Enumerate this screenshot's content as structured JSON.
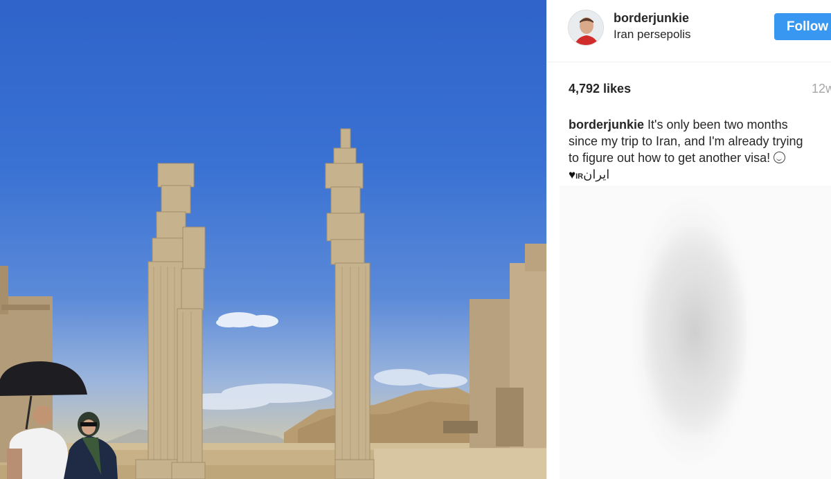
{
  "post": {
    "username": "borderjunkie",
    "location": "Iran persepolis",
    "follow_label": "Follow",
    "likes": "4,792 likes",
    "time_ago": "12w",
    "caption": {
      "username": "borderjunkie",
      "text": " It's only been two months since my trip to Iran, and I'm already trying to figure out how to get another visa! ",
      "heart": "♥",
      "flag": "IR",
      "persian": "ایران"
    }
  },
  "colors": {
    "follow_button": "#3897f0",
    "time_text": "#a7a7a7"
  },
  "icons": [
    "smiling-face-icon",
    "heart-icon"
  ]
}
